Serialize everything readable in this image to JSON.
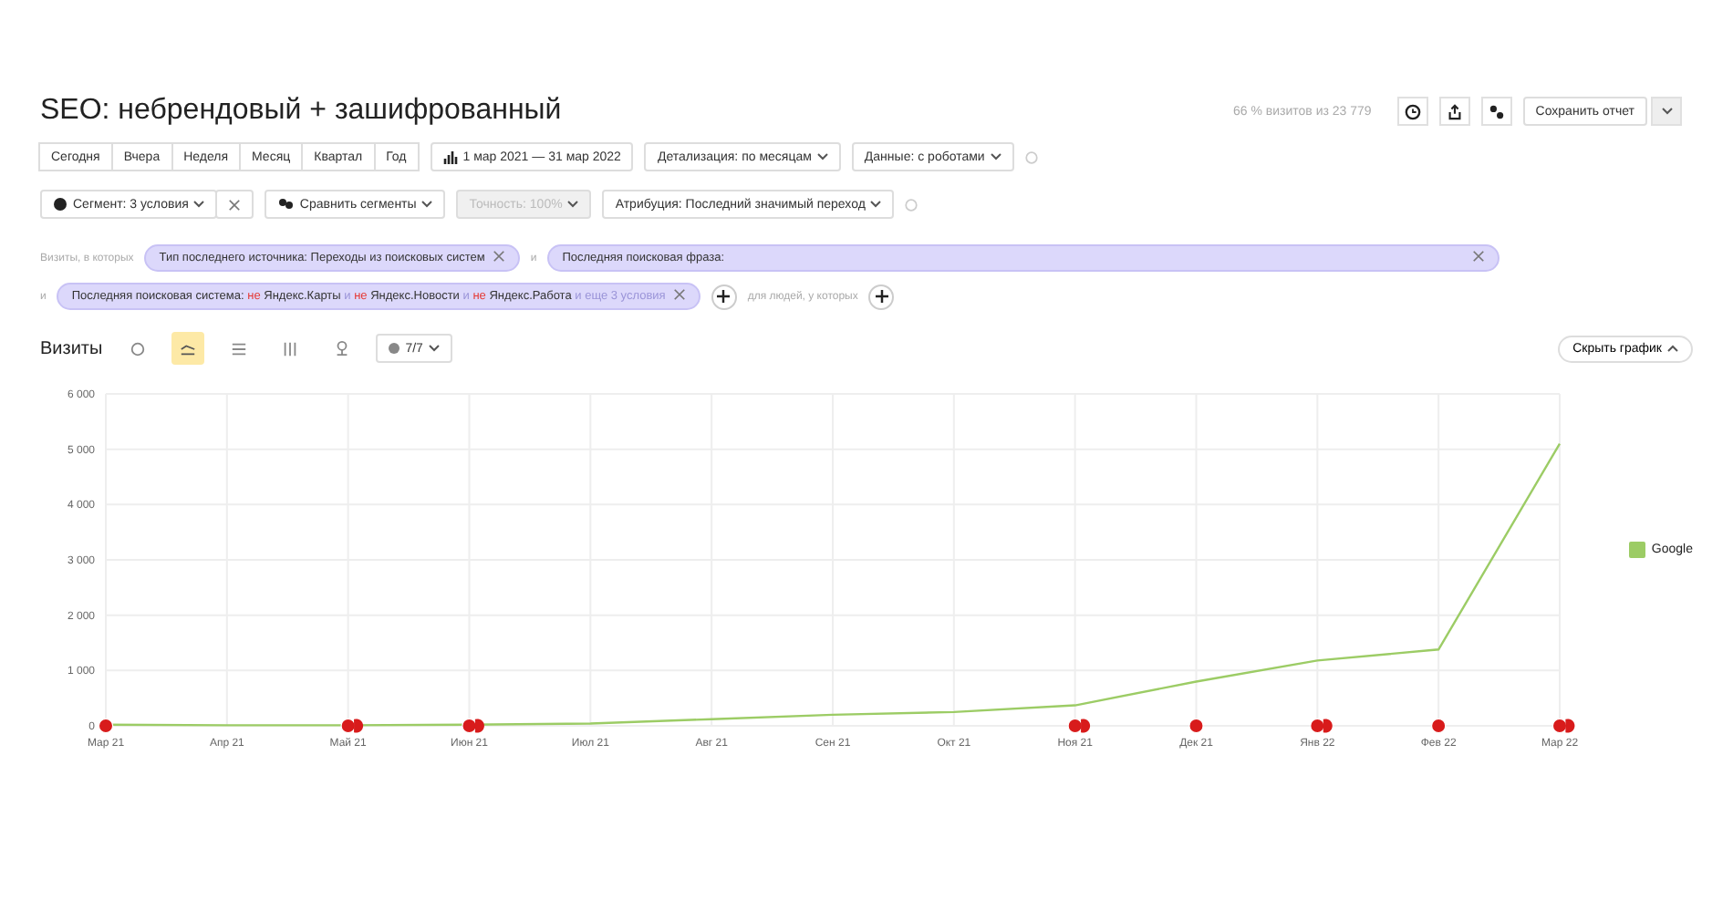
{
  "title": "SEO: небрендовый + зашифрованный",
  "sample_info": "66 % визитов из 23 779",
  "save_button": "Сохранить отчет",
  "periods": [
    {
      "label": "Сегодня",
      "selected": false
    },
    {
      "label": "Вчера",
      "selected": false
    },
    {
      "label": "Неделя",
      "selected": false
    },
    {
      "label": "Месяц",
      "selected": false
    },
    {
      "label": "Квартал",
      "selected": false
    },
    {
      "label": "Год",
      "selected": false
    }
  ],
  "date_range": "1 мар 2021 — 31 мар 2022",
  "detail_dropdown": "Детализация: по месяцам",
  "data_dropdown": "Данные: с роботами",
  "segment_dropdown": "Сегмент: 3 условия",
  "compare_dropdown": "Сравнить сегменты",
  "accuracy_dropdown": {
    "label": "Точность: 100%",
    "disabled": true
  },
  "attribution_dropdown": "Атрибуция: Последний значимый переход",
  "filters": {
    "label": "Визиты, в которых",
    "joiner_1": "и",
    "joiner_2": "и",
    "people_label": "для людей, у которых",
    "chips": [
      {
        "wide": false,
        "parts": [
          {
            "text": "Тип последнего источника: Переходы из поисковых систем",
            "kind": "normal"
          }
        ]
      },
      {
        "wide": true,
        "parts": [
          {
            "text": "Последняя поисковая фраза:",
            "kind": "normal"
          }
        ]
      },
      {
        "wide": false,
        "parts": [
          {
            "text": "Последняя поисковая система: ",
            "kind": "normal"
          },
          {
            "text": "не",
            "kind": "negation"
          },
          {
            "text": " Яндекс.Карты ",
            "kind": "normal"
          },
          {
            "text": "и",
            "kind": "muted"
          },
          {
            "text": " не",
            "kind": "negation"
          },
          {
            "text": " Яндекс.Новости ",
            "kind": "normal"
          },
          {
            "text": "и",
            "kind": "muted"
          },
          {
            "text": " не",
            "kind": "negation"
          },
          {
            "text": " Яндекс.Работа ",
            "kind": "normal"
          },
          {
            "text": "и еще 3 условия",
            "kind": "muted"
          }
        ]
      }
    ]
  },
  "chart_header": {
    "title": "Визиты",
    "chart_types": [
      {
        "kind": "pie",
        "selected": false
      },
      {
        "kind": "line",
        "selected": true
      },
      {
        "kind": "stacked",
        "selected": false
      },
      {
        "kind": "bars",
        "selected": false
      },
      {
        "kind": "map",
        "selected": false
      }
    ],
    "series_count": "7/7",
    "hide_button": "Скрыть график"
  },
  "chart": {
    "chart_data": {
      "type": "line",
      "categories": [
        "Мар 21",
        "Апр 21",
        "Май 21",
        "Июн 21",
        "Июл 21",
        "Авг 21",
        "Сен 21",
        "Окт 21",
        "Ноя 21",
        "Дек 21",
        "Янв 22",
        "Фев 22",
        "Мар 22"
      ],
      "series": [
        {
          "name": "Google",
          "color": "#9ccc65",
          "values": [
            20,
            10,
            10,
            20,
            40,
            120,
            200,
            250,
            370,
            800,
            1180,
            1380,
            5100
          ]
        }
      ],
      "ylim": [
        0,
        6000
      ],
      "grid": true,
      "yticks": [
        {
          "value": 0,
          "label": "0"
        },
        {
          "value": 1000,
          "label": "1 000"
        },
        {
          "value": 2000,
          "label": "2 000"
        },
        {
          "value": 3000,
          "label": "3 000"
        },
        {
          "value": 4000,
          "label": "4 000"
        },
        {
          "value": 5000,
          "label": "5 000"
        },
        {
          "value": 6000,
          "label": "6 000"
        }
      ]
    },
    "legend_checked": true,
    "event_markers": [
      {
        "shown": true,
        "multiple": false
      },
      {
        "shown": false
      },
      {
        "shown": true,
        "multiple": true
      },
      {
        "shown": true,
        "multiple": true
      },
      {
        "shown": false
      },
      {
        "shown": false
      },
      {
        "shown": false
      },
      {
        "shown": false
      },
      {
        "shown": true,
        "multiple": true
      },
      {
        "shown": true,
        "multiple": false
      },
      {
        "shown": true,
        "multiple": true
      },
      {
        "shown": true,
        "multiple": false
      },
      {
        "shown": true,
        "multiple": true
      }
    ]
  }
}
